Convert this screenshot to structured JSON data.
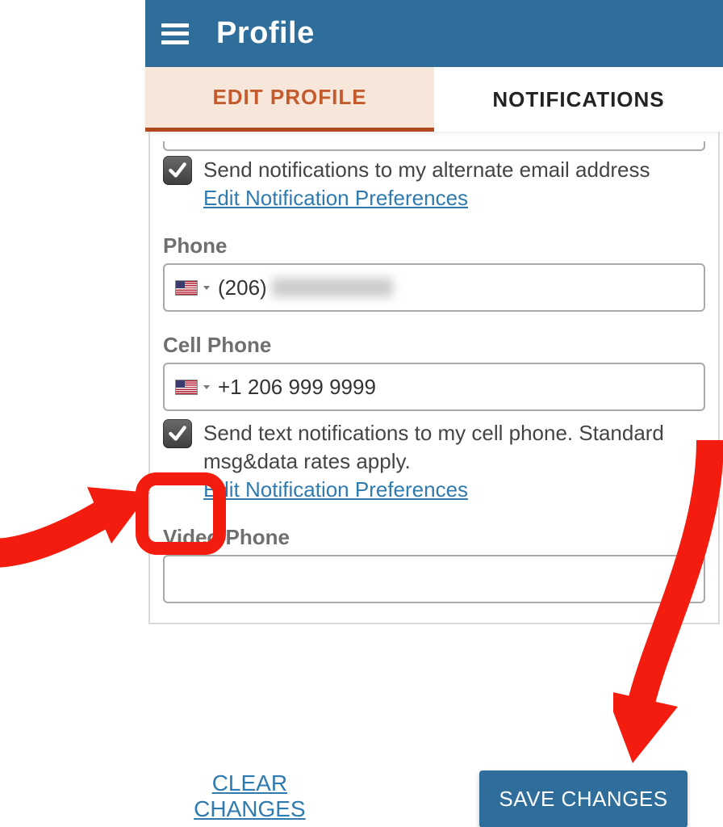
{
  "header": {
    "title": "Profile"
  },
  "tabs": {
    "active": "EDIT PROFILE",
    "other": "NOTIFICATIONS"
  },
  "form": {
    "email_notify": {
      "label": "Send notifications to my alternate email address",
      "pref_link": "Edit Notification Preferences"
    },
    "phone": {
      "label": "Phone",
      "prefix": "(206)"
    },
    "cell": {
      "label": "Cell Phone",
      "value": "+1 206 999 9999",
      "notify_label": "Send text notifications to my cell phone. Standard msg&data rates apply.",
      "pref_link": "Edit Notification Preferences"
    },
    "video": {
      "label": "Video Phone",
      "value": ""
    }
  },
  "buttons": {
    "clear": "CLEAR CHANGES",
    "save": "SAVE CHANGES"
  }
}
